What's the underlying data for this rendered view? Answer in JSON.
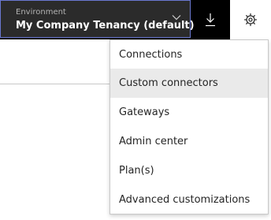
{
  "header": {
    "environment": {
      "caption": "Environment",
      "value": "My Company Tenancy (default)",
      "expand_icon": "chevron-down-icon"
    },
    "download_icon": "download-icon",
    "settings_icon": "gear-icon"
  },
  "settings_menu": {
    "highlighted_index": 1,
    "items": [
      {
        "label": "Connections"
      },
      {
        "label": "Custom connectors"
      },
      {
        "label": "Gateways"
      },
      {
        "label": "Admin center"
      },
      {
        "label": "Plan(s)"
      },
      {
        "label": "Advanced customizations"
      }
    ]
  },
  "colors": {
    "topbar": "#000000",
    "environment_bg": "#2b2b2b",
    "focus_border": "#6a78d1",
    "menu_hover": "#eaeaea"
  }
}
